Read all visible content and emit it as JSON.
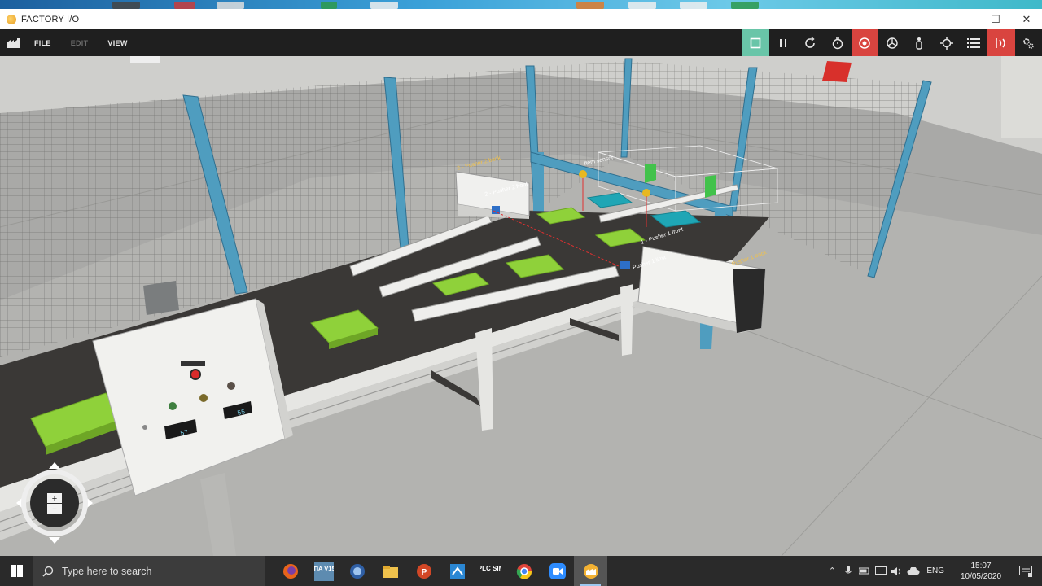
{
  "window": {
    "title": "FACTORY I/O"
  },
  "menu": {
    "file": "FILE",
    "edit": "EDIT",
    "view": "VIEW"
  },
  "toolbar": {
    "tools": [
      "stop-square-icon",
      "pause-icon",
      "reset-icon",
      "timer-icon",
      "sensor-view-icon",
      "camera-fly-icon",
      "person-icon",
      "target-icon",
      "list-icon",
      "driver-io-icon",
      "settings-gear-icon"
    ]
  },
  "scene": {
    "labels": {
      "pusher1_front": "1 - Pusher 1 front",
      "pusher1_limit": "Pusher 1 limit",
      "pusher2_back": "2 - Pusher 2 back",
      "pusher2_front": "2 - Pusher 2 front",
      "pusher1_back": "Pusher 1 back",
      "item_sensor": "Item sensor"
    },
    "panel": {
      "counter_left": "57",
      "counter_right": "55"
    },
    "colors": {
      "box_green": "#8fd13a",
      "box_teal": "#1fa6b5",
      "frame_blue": "#4f9dbf",
      "conveyor_belt": "#3a3836"
    }
  },
  "taskbar": {
    "search_placeholder": "Type here to search",
    "apps": [
      "firefox-icon",
      "tia-v15-icon",
      "app-circle-icon",
      "file-explorer-icon",
      "powerpoint-icon",
      "network-icon",
      "plcsim-icon",
      "chrome-icon",
      "zoom-icon",
      "factory-io-icon"
    ],
    "tia_label": "TIA V15",
    "plc_label": "PLC SIM",
    "language": "ENG",
    "time": "15:07",
    "date": "10/05/2020"
  }
}
